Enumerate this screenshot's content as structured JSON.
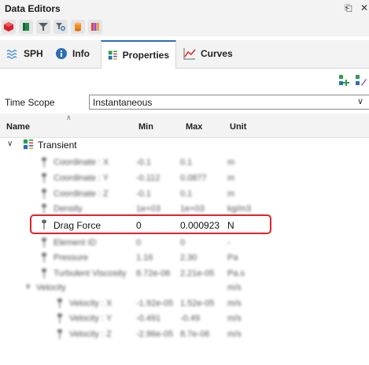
{
  "window": {
    "title": "Data Editors",
    "controls": [
      "restore-icon",
      "close-icon"
    ]
  },
  "toolbar": {
    "icons": [
      "red-cube-icon",
      "green-flag-icon",
      "funnel-icon",
      "filter-search-icon",
      "cylinder-icon",
      "color-palette-icon"
    ]
  },
  "tabs": [
    {
      "label": "SPH",
      "icon": "waves-icon",
      "active": false
    },
    {
      "label": "Info",
      "icon": "info-icon",
      "active": false
    },
    {
      "label": "Properties",
      "icon": "properties-icon",
      "active": true
    },
    {
      "label": "Curves",
      "icon": "line-chart-icon",
      "active": false
    }
  ],
  "actions": [
    "add-property-icon",
    "edit-property-icon"
  ],
  "time_scope": {
    "label": "Time Scope",
    "value": "Instantaneous"
  },
  "grid": {
    "columns": {
      "name": "Name",
      "min": "Min",
      "max": "Max",
      "unit": "Unit"
    },
    "group": {
      "label": "Transient",
      "expanded": true
    },
    "rows": [
      {
        "name": "Coordinate : X",
        "min": "-0.1",
        "max": "0.1",
        "unit": "m",
        "blurred": true
      },
      {
        "name": "Coordinate : Y",
        "min": "-0.112",
        "max": "0.0877",
        "unit": "m",
        "blurred": true
      },
      {
        "name": "Coordinate : Z",
        "min": "-0.1",
        "max": "0.1",
        "unit": "m",
        "blurred": true
      },
      {
        "name": "Density",
        "min": "1e+03",
        "max": "1e+03",
        "unit": "kg/m3",
        "blurred": true
      },
      {
        "name": "Drag Force",
        "min": "0",
        "max": "0.000923",
        "unit": "N",
        "blurred": false
      },
      {
        "name": "Element ID",
        "min": "0",
        "max": "0",
        "unit": "-",
        "blurred": true
      },
      {
        "name": "Pressure",
        "min": "1.16",
        "max": "2.30",
        "unit": "Pa",
        "blurred": true
      },
      {
        "name": "Turbulent Viscosity",
        "min": "8.72e-06",
        "max": "2.21e-05",
        "unit": "Pa.s",
        "blurred": true
      },
      {
        "name": "Velocity",
        "min": "",
        "max": "",
        "unit": "m/s",
        "blurred": true
      },
      {
        "name": "Velocity : X",
        "min": "-1.92e-05",
        "max": "1.52e-05",
        "unit": "m/s",
        "blurred": true
      },
      {
        "name": "Velocity : Y",
        "min": "-0.491",
        "max": "-0.49",
        "unit": "m/s",
        "blurred": true
      },
      {
        "name": "Velocity : Z",
        "min": "-2.96e-05",
        "max": "8.7e-06",
        "unit": "m/s",
        "blurred": true
      }
    ]
  },
  "colors": {
    "highlight": "#e0232b",
    "accent": "#2d6db5"
  }
}
